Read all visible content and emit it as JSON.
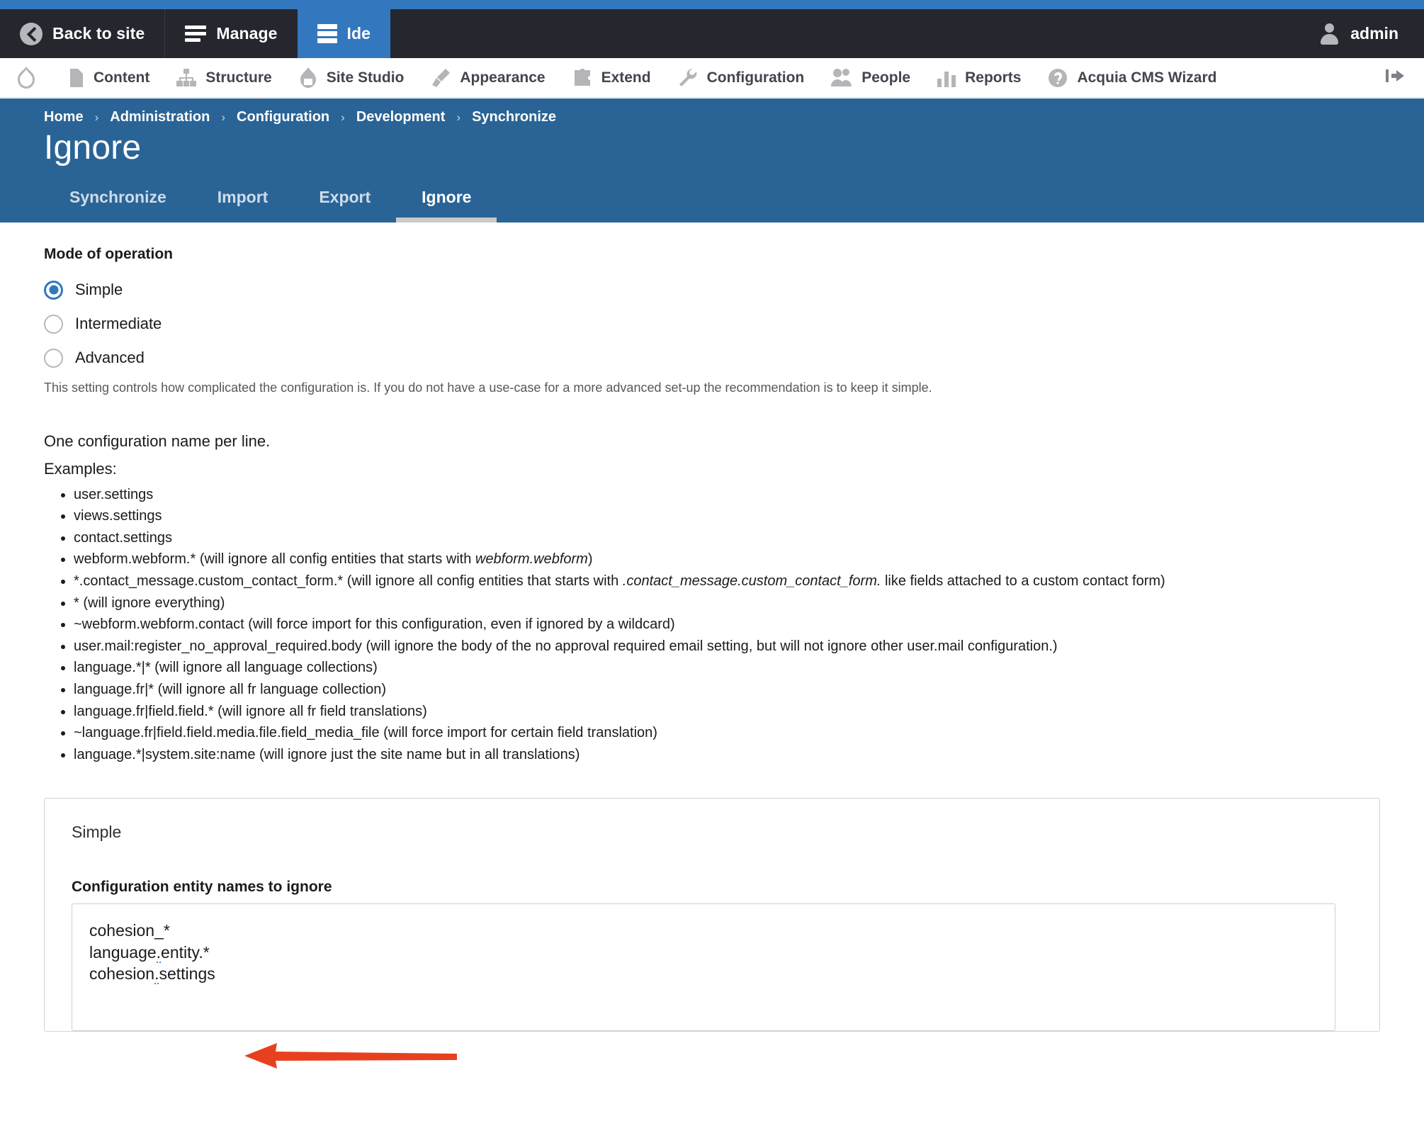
{
  "admin_toolbar": {
    "back_label": "Back to site",
    "manage_label": "Manage",
    "ide_label": "Ide",
    "user_label": "admin",
    "icons": {
      "back": "back-chevron-icon",
      "manage": "hamburger-icon",
      "ide": "server-stack-icon",
      "user": "user-avatar-icon"
    }
  },
  "menu_bar": {
    "items": [
      {
        "label": "Content",
        "icon": "file-icon"
      },
      {
        "label": "Structure",
        "icon": "sitemap-icon"
      },
      {
        "label": "Site Studio",
        "icon": "droplet-icon"
      },
      {
        "label": "Appearance",
        "icon": "paintbrush-icon"
      },
      {
        "label": "Extend",
        "icon": "puzzle-piece-icon"
      },
      {
        "label": "Configuration",
        "icon": "wrench-icon"
      },
      {
        "label": "People",
        "icon": "people-icon"
      },
      {
        "label": "Reports",
        "icon": "bar-chart-icon"
      },
      {
        "label": "Acquia CMS Wizard",
        "icon": "question-circle-icon"
      }
    ],
    "logo_icon": "drupal-drop-icon",
    "collapse_icon": "collapse-sidebar-icon"
  },
  "page_header": {
    "breadcrumb": [
      "Home",
      "Administration",
      "Configuration",
      "Development",
      "Synchronize"
    ],
    "breadcrumb_separator": "›",
    "title": "Ignore",
    "tabs": [
      {
        "label": "Synchronize",
        "active": false
      },
      {
        "label": "Import",
        "active": false
      },
      {
        "label": "Export",
        "active": false
      },
      {
        "label": "Ignore",
        "active": true
      }
    ]
  },
  "form": {
    "mode_label": "Mode of operation",
    "mode_options": [
      {
        "label": "Simple",
        "checked": true
      },
      {
        "label": "Intermediate",
        "checked": false
      },
      {
        "label": "Advanced",
        "checked": false
      }
    ],
    "mode_help": "This setting controls how complicated the configuration is. If you do not have a use-case for a more advanced set-up the recommendation is to keep it simple.",
    "intro_line": "One configuration name per line.",
    "examples_label": "Examples:",
    "examples": [
      "user.settings",
      "views.settings",
      "contact.settings",
      "webform.webform.* (will ignore all config entities that starts with webform.webform)",
      "*.contact_message.custom_contact_form.* (will ignore all config entities that starts with .contact_message.custom_contact_form. like fields attached to a custom contact form)",
      "* (will ignore everything)",
      "~webform.webform.contact (will force import for this configuration, even if ignored by a wildcard)",
      "user.mail:register_no_approval_required.body (will ignore the body of the no approval required email setting, but will not ignore other user.mail configuration.)",
      "language.*|* (will ignore all language collections)",
      "language.fr|* (will ignore all fr language collection)",
      "language.fr|field.field.* (will ignore all fr field translations)",
      "~language.fr|field.field.media.file.field_media_file (will force import for certain field translation)",
      "language.*|system.site:name (will ignore just the site name but in all translations)"
    ],
    "card_title": "Simple",
    "textarea_label": "Configuration entity names to ignore",
    "textarea_value": "cohesion_*\nlanguage.entity.*\ncohesion.settings",
    "textarea_lines": [
      "cohesion_*",
      "language.entity.*",
      "cohesion.settings"
    ]
  },
  "annotation": {
    "arrow_icon": "red-pointer-arrow-icon",
    "arrow_color": "#e8401f",
    "points_at": "cohesion.settings"
  },
  "colors": {
    "top_strip": "#3378be",
    "admin_bar": "#25262e",
    "active_tab": "#3378be",
    "page_header": "#2a6496",
    "radio_accent": "#3378be",
    "annotation_red": "#e8401f"
  }
}
